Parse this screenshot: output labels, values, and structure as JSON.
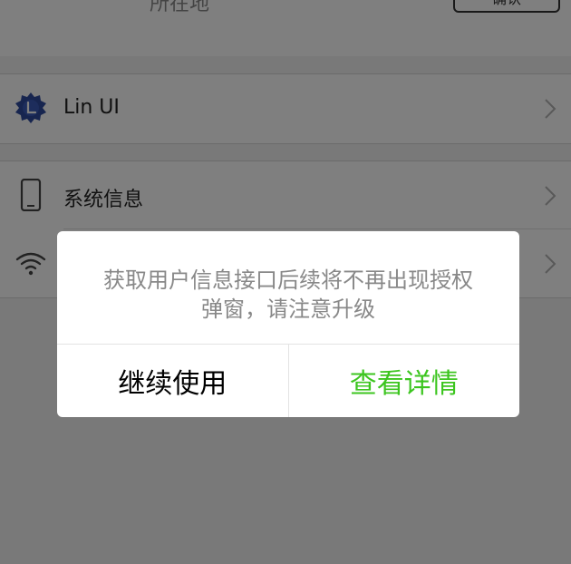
{
  "header": {
    "partial_text": "所在地",
    "partial_button": "确认"
  },
  "menu": {
    "group1": [
      {
        "label": "Lin UI",
        "icon": "lin-ui-logo-icon"
      }
    ],
    "group2": [
      {
        "label": "系统信息",
        "icon": "phone-icon"
      },
      {
        "label": "",
        "icon": "wifi-icon"
      }
    ]
  },
  "dialog": {
    "content": "获取用户信息接口后续将不再出现授权弹窗，请注意升级",
    "cancel_label": "继续使用",
    "confirm_label": "查看详情",
    "cancel_color": "#000000",
    "confirm_color": "#3cc51f"
  },
  "colors": {
    "overlay": "rgba(0,0,0,0.5)",
    "lin_ui_brand": "#2f4a9e"
  }
}
